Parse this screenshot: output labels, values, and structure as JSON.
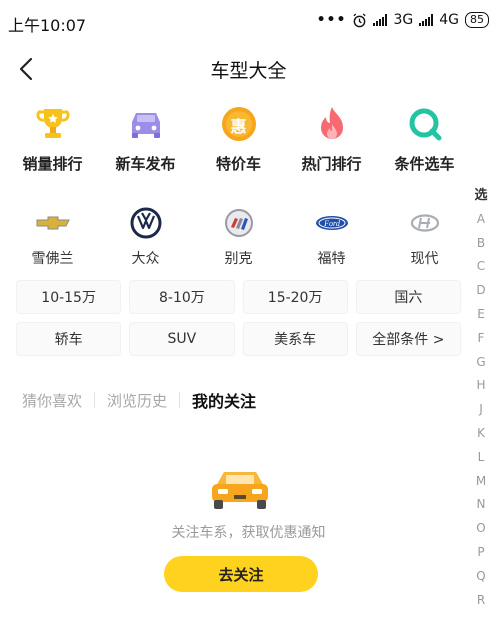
{
  "status": {
    "time": "上午10:07",
    "net1": "3G",
    "net2": "4G",
    "battery": "85"
  },
  "header": {
    "title": "车型大全"
  },
  "categories": [
    {
      "label": "销量排行",
      "icon": "trophy-icon"
    },
    {
      "label": "新车发布",
      "icon": "new-car-icon"
    },
    {
      "label": "特价车",
      "icon": "sale-badge-icon",
      "badge": "惠"
    },
    {
      "label": "热门排行",
      "icon": "flame-icon"
    },
    {
      "label": "条件选车",
      "icon": "search-icon"
    }
  ],
  "brands": [
    {
      "label": "雪佛兰",
      "icon": "chevrolet-logo-icon"
    },
    {
      "label": "大众",
      "icon": "volkswagen-logo-icon"
    },
    {
      "label": "别克",
      "icon": "buick-logo-icon"
    },
    {
      "label": "福特",
      "icon": "ford-logo-icon"
    },
    {
      "label": "现代",
      "icon": "hyundai-logo-icon"
    }
  ],
  "filters_row1": [
    "10-15万",
    "8-10万",
    "15-20万",
    "国六"
  ],
  "filters_row2": [
    "轿车",
    "SUV",
    "美系车",
    "全部条件 >"
  ],
  "tabs": [
    {
      "label": "猜你喜欢",
      "active": false
    },
    {
      "label": "浏览历史",
      "active": false
    },
    {
      "label": "我的关注",
      "active": true
    }
  ],
  "empty": {
    "text": "关注车系，获取优惠通知",
    "button": "去关注"
  },
  "alphabet": [
    "选",
    "A",
    "B",
    "C",
    "D",
    "E",
    "F",
    "G",
    "H",
    "J",
    "K",
    "L",
    "M",
    "N",
    "O",
    "P",
    "Q",
    "R"
  ],
  "colors": {
    "accent": "#ffd21f",
    "muted": "#a8a8a8"
  }
}
